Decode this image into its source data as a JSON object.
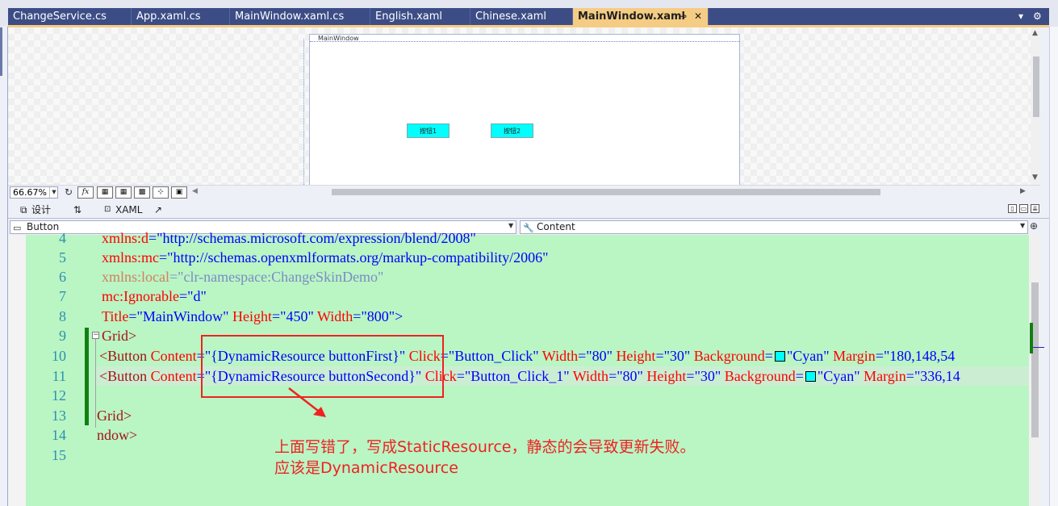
{
  "tabs": [
    {
      "label": "ChangeService.cs"
    },
    {
      "label": "App.xaml.cs"
    },
    {
      "label": "MainWindow.xaml.cs"
    },
    {
      "label": "English.xaml"
    },
    {
      "label": "Chinese.xaml"
    },
    {
      "label": "MainWindow.xaml"
    }
  ],
  "tab_actions": {
    "pin": "⊸",
    "close": "✕",
    "overflow": "▾",
    "settings": "⚙"
  },
  "designer": {
    "window_title": "MainWindow",
    "button1": "按钮1",
    "button2": "按钮2"
  },
  "zoom": {
    "level": "66.67%"
  },
  "toolbar_icons": [
    "fx-icon",
    "grid-icon",
    "snap-grid-icon",
    "artboard-icon",
    "snap-lines-icon",
    "project-code-icon"
  ],
  "split": {
    "design_label": "设计",
    "swap_label": "⇅",
    "xaml_label": "XAML"
  },
  "nav": {
    "left_value": "Button",
    "right_value": "Content"
  },
  "line_numbers": [
    "4",
    "5",
    "6",
    "7",
    "8",
    "9",
    "10",
    "11",
    "12",
    "13",
    "14",
    "15"
  ],
  "code": {
    "l4_attr": "xmlns:d",
    "l4_val": "=\"http://schemas.microsoft.com/expression/blend/2008\"",
    "l5_attr": "xmlns:mc",
    "l5_val": "=\"http://schemas.openxmlformats.org/markup-compatibility/2006\"",
    "l6_attr": "xmlns:local",
    "l6_val": "=\"clr-namespace:ChangeSkinDemo\"",
    "l7_attr": "mc:Ignorable",
    "l7_val": "=\"d\"",
    "l8_a1": "Title",
    "l8_v1": "=\"MainWindow\"",
    "l8_a2": " Height",
    "l8_v2": "=\"450\"",
    "l8_a3": " Width",
    "l8_v3": "=\"800\"",
    "l8_end": ">",
    "l9": "Grid>",
    "l10_tag": "<Button",
    "l10_a1": " Content",
    "l10_v1": "=\"{DynamicResource buttonFirst}\"",
    "l10_a2": " Click",
    "l10_v2": "=\"Button_Click\"",
    "l10_a3": " Width",
    "l10_v3": "=\"80\"",
    "l10_a4": " Height",
    "l10_v4": "=\"30\"",
    "l10_a5": " Background",
    "l10_v5a": "=",
    "l10_v5b": "\"Cyan\"",
    "l10_a6": " Margin",
    "l10_v6": "=\"180,148,54",
    "l11_tag": "<Button",
    "l11_a1": " Content",
    "l11_v1": "=\"{DynamicResource buttonSecond}\"",
    "l11_a2": " Click",
    "l11_v2": "=\"Button_Click_1\"",
    "l11_a3": " Width",
    "l11_v3": "=\"80\"",
    "l11_a4": " Height",
    "l11_v4": "=\"30\"",
    "l11_a5": " Background",
    "l11_v5a": "=",
    "l11_v5b": "\"Cyan\"",
    "l11_a6": " Margin",
    "l11_v6": "=\"336,14",
    "l13": "Grid>",
    "l14": "ndow>"
  },
  "annotation": {
    "line1": "上面写错了，写成StaticResource，静态的会导致更新失败。",
    "line2": "应该是DynamicResource"
  },
  "colors": {
    "tab_bg": "#3c4d86",
    "tab_active": "#f5cc84",
    "editor_bg": "#baf5c4",
    "annotation": "#ee2222",
    "cyan": "#00ffff"
  }
}
